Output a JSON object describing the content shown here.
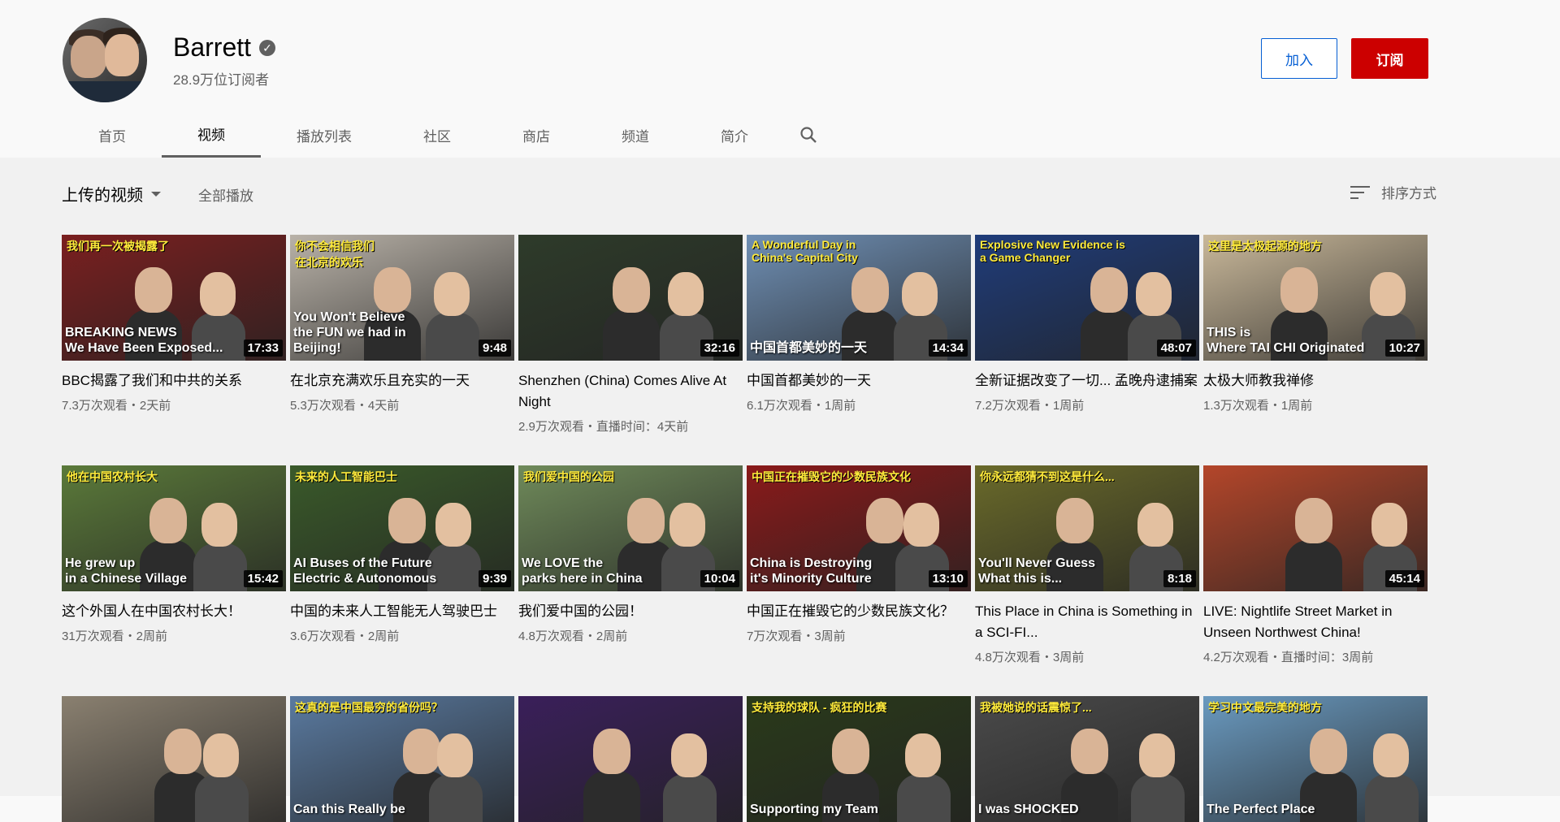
{
  "channel": {
    "name": "Barrett",
    "verified_icon": "check-circle-icon",
    "subscribers": "28.9万位订阅者",
    "join_label": "加入",
    "subscribe_label": "订阅",
    "colors": {
      "subscribe": "#cc0000",
      "join": "#065fd4"
    }
  },
  "tabs": [
    {
      "label": "首页"
    },
    {
      "label": "视频",
      "active": true
    },
    {
      "label": "播放列表"
    },
    {
      "label": "社区"
    },
    {
      "label": "商店"
    },
    {
      "label": "频道"
    },
    {
      "label": "简介"
    }
  ],
  "section": {
    "title": "上传的视频",
    "play_all": "全部播放",
    "sort_label": "排序方式"
  },
  "videos": [
    {
      "banner": "我们再一次被揭露了",
      "caption": "BREAKING NEWS\nWe Have Been Exposed...",
      "duration": "17:33",
      "title": "BBC揭露了我们和中共的关系",
      "meta": "7.3万次观看・2天前"
    },
    {
      "banner": "你不会相信我们\n在北京的欢乐",
      "caption": "You Won't Believe\nthe FUN we had in Beijing!",
      "duration": "9:48",
      "title": "在北京充满欢乐且充实的一天",
      "meta": "5.3万次观看・4天前"
    },
    {
      "banner": "",
      "caption": "",
      "duration": "32:16",
      "title": "Shenzhen (China) Comes Alive At Night",
      "meta": "2.9万次观看・直播时间：4天前"
    },
    {
      "banner": "A Wonderful Day in\nChina's Capital City",
      "caption": "中国首都美妙的一天",
      "duration": "14:34",
      "title": "中国首都美妙的一天",
      "meta": "6.1万次观看・1周前"
    },
    {
      "banner": "Explosive New Evidence is\na Game Changer",
      "caption": "",
      "duration": "48:07",
      "title": "全新证据改变了一切... 孟晚舟逮捕案",
      "meta": "7.2万次观看・1周前"
    },
    {
      "banner": "这里是太极起源的地方",
      "caption": "THIS is\nWhere TAI CHI Originated",
      "duration": "10:27",
      "title": "太极大师教我禅修",
      "meta": "1.3万次观看・1周前"
    },
    {
      "banner": "他在中国农村长大",
      "caption": "He grew up\nin a Chinese Village",
      "duration": "15:42",
      "title": "这个外国人在中国农村长大！",
      "meta": "31万次观看・2周前"
    },
    {
      "banner": "未来的人工智能巴士",
      "caption": "AI Buses of the Future\nElectric & Autonomous",
      "duration": "9:39",
      "title": "中国的未来人工智能无人驾驶巴士",
      "meta": "3.6万次观看・2周前"
    },
    {
      "banner": "我们爱中国的公园",
      "caption": "We LOVE the\nparks here in China",
      "duration": "10:04",
      "title": "我们爱中国的公园！",
      "meta": "4.8万次观看・2周前"
    },
    {
      "banner": "中国正在摧毁它的少数民族文化",
      "caption": "China is Destroying\nit's Minority Culture",
      "duration": "13:10",
      "title": "中国正在摧毁它的少数民族文化？",
      "meta": "7万次观看・3周前"
    },
    {
      "banner": "你永远都猜不到这是什么...",
      "caption": "You'll Never Guess\nWhat this is...",
      "duration": "8:18",
      "title": "This Place in China is Something in a SCI-FI...",
      "meta": "4.8万次观看・3周前"
    },
    {
      "banner": "",
      "caption": "",
      "duration": "45:14",
      "title": "LIVE: Nightlife Street Market in Unseen Northwest China!",
      "meta": "4.2万次观看・直播时间：3周前"
    },
    {
      "banner": "",
      "caption": "",
      "duration": "",
      "title": "",
      "meta": ""
    },
    {
      "banner": "这真的是中国最穷的省份吗？",
      "caption": "Can this Really be",
      "duration": "",
      "title": "",
      "meta": ""
    },
    {
      "banner": "",
      "caption": "",
      "duration": "",
      "title": "",
      "meta": ""
    },
    {
      "banner": "支持我的球队 - 疯狂的比赛",
      "caption": "Supporting my Team",
      "duration": "",
      "title": "",
      "meta": ""
    },
    {
      "banner": "我被她说的话震惊了...",
      "caption": "I was SHOCKED",
      "duration": "",
      "title": "",
      "meta": ""
    },
    {
      "banner": "学习中文最完美的地方",
      "caption": "The Perfect Place",
      "duration": "",
      "title": "",
      "meta": ""
    }
  ],
  "thumb_colors": [
    "#7a1f1f",
    "#b9b2a8",
    "#2e3b2a",
    "#6f8fb4",
    "#1f3c7a",
    "#c9b89a",
    "#5b7a3a",
    "#3a5a2a",
    "#6f8a5a",
    "#8a1a1a",
    "#6a6a2a",
    "#b4462a",
    "#8a8070",
    "#5a7aa0",
    "#3a1f5a",
    "#2a3a1a",
    "#4a4a4a",
    "#6a9ac0"
  ]
}
